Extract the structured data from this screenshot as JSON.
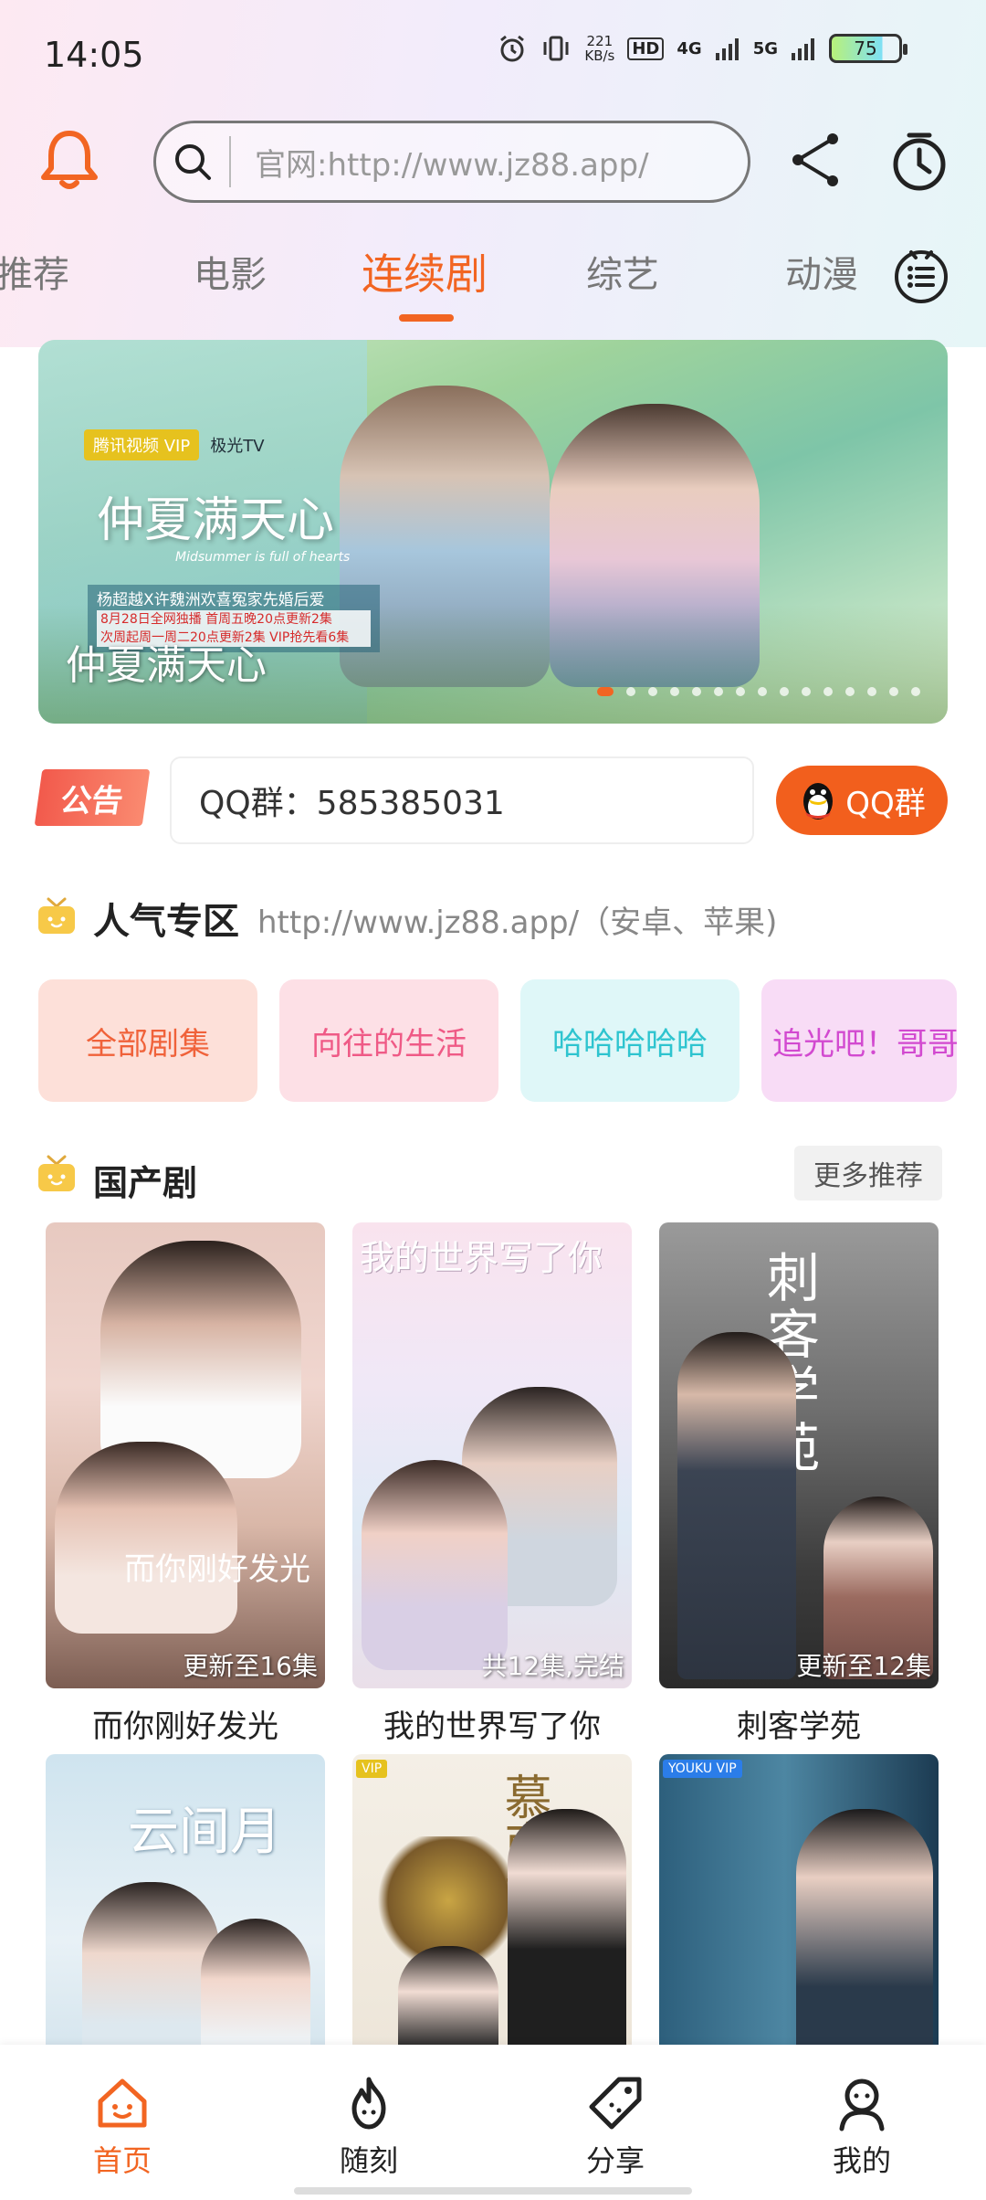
{
  "status_bar": {
    "time": "14:05",
    "net_speed": "221",
    "net_unit": "KB/s",
    "hd": "HD",
    "sig1": "4G",
    "sig2": "5G",
    "battery": "75"
  },
  "header": {
    "search_placeholder": "官网:http://www.jz88.app/"
  },
  "tabs": [
    {
      "label": "推荐"
    },
    {
      "label": "电影"
    },
    {
      "label": "连续剧",
      "active": true
    },
    {
      "label": "综艺"
    },
    {
      "label": "动漫"
    }
  ],
  "banner": {
    "logo_tx": "腾讯视频 VIP",
    "logo_jg": "极光TV",
    "title": "仲夏满天心",
    "subtitle_en": "Midsummer is full of hearts",
    "info_line1": "杨超越X许魏洲欢喜冤家先婚后爱",
    "info_line2": "8月28日全网独播 首周五晚20点更新2集",
    "info_line3": "次周起周一周二20点更新2集 VIP抢先看6集",
    "caption": "仲夏满天心",
    "slide_count": 15,
    "active_slide": 0
  },
  "notice": {
    "badge": "公告",
    "text": "QQ群：585385031",
    "qq_button": "QQ群"
  },
  "popular": {
    "title": "人气专区",
    "url": "http://www.jz88.app/（安卓、苹果)",
    "chips": [
      {
        "label": "全部剧集",
        "bg": "#fde0d9",
        "fg": "#f0623a"
      },
      {
        "label": "向往的生活",
        "bg": "#fde0e6",
        "fg": "#ef5a86"
      },
      {
        "label": "哈哈哈哈哈",
        "bg": "#dff7f8",
        "fg": "#2ec4cf"
      },
      {
        "label": "追光吧！哥哥",
        "bg": "#f8dcf6",
        "fg": "#d24ad0"
      }
    ]
  },
  "domestic": {
    "title": "国产剧",
    "more": "更多推荐",
    "cards": [
      {
        "title": "而你刚好发光",
        "badge": "更新至16集",
        "poster_text": "而你刚好发光"
      },
      {
        "title": "我的世界写了你",
        "badge": "共12集,完结",
        "poster_text": "我的世界写了你"
      },
      {
        "title": "刺客学苑",
        "badge": "更新至12集",
        "poster_text": "刺客学苑"
      },
      {
        "title": "",
        "badge": "",
        "poster_text": "云间月"
      },
      {
        "title": "",
        "badge": "",
        "poster_text": "慕南枝"
      },
      {
        "title": "",
        "badge": "",
        "poster_text": ""
      }
    ]
  },
  "bottom_nav": [
    {
      "label": "首页",
      "icon": "home-icon",
      "active": true
    },
    {
      "label": "随刻",
      "icon": "flame-icon"
    },
    {
      "label": "分享",
      "icon": "tag-icon"
    },
    {
      "label": "我的",
      "icon": "user-icon"
    }
  ],
  "colors": {
    "accent": "#f26522",
    "qq": "#f25f1d"
  }
}
